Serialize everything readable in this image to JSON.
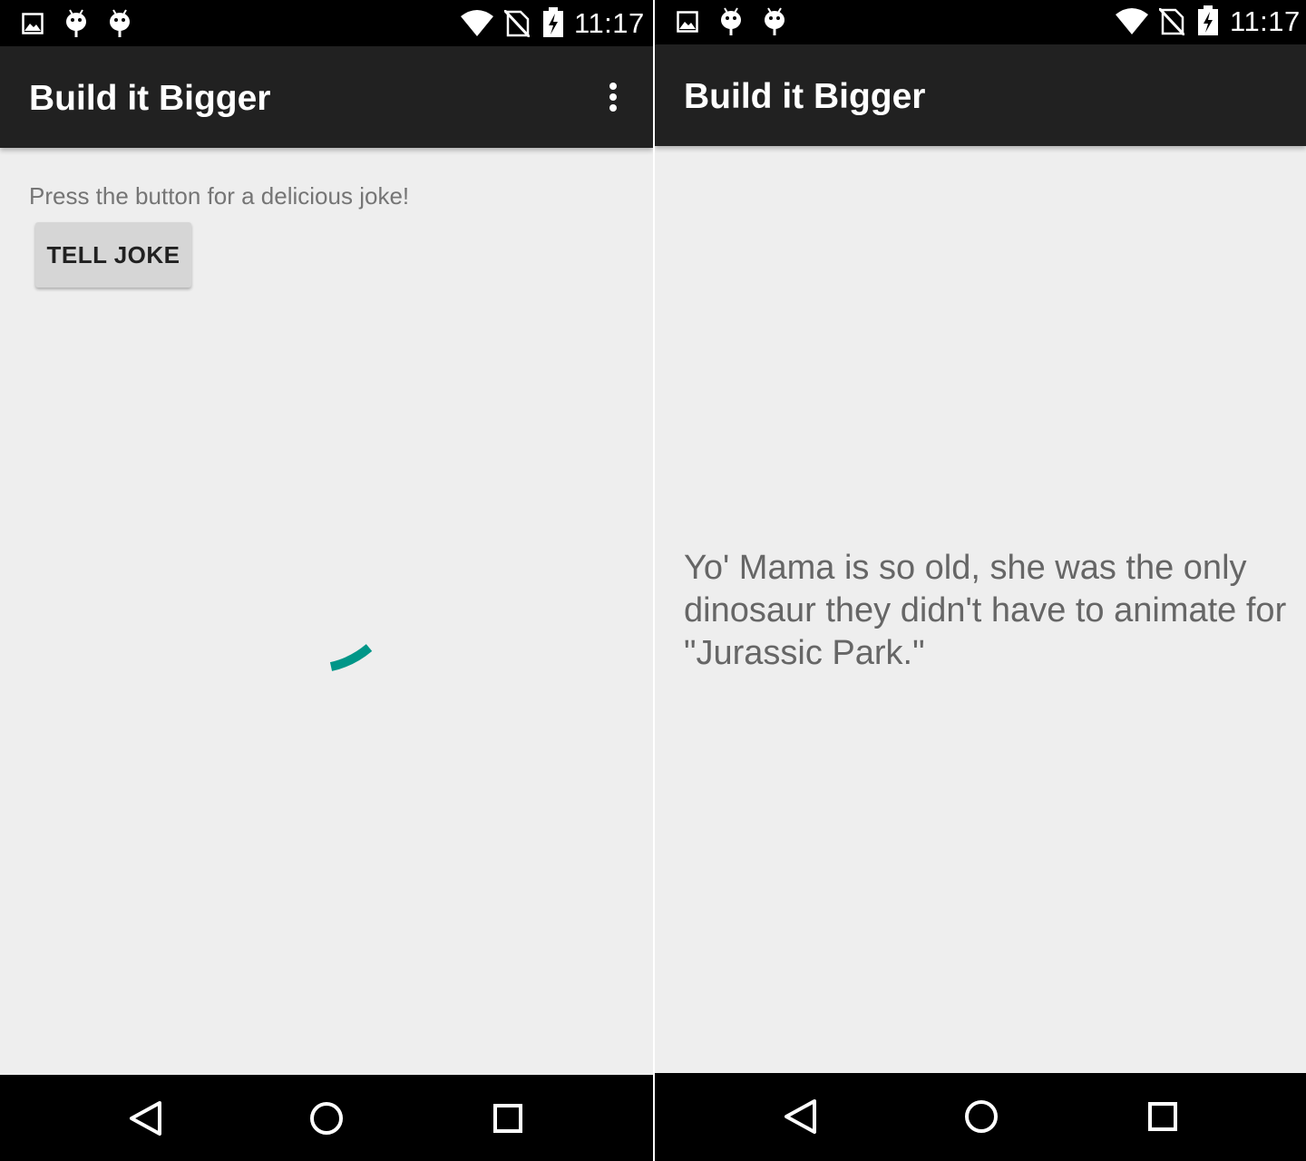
{
  "status_bar": {
    "time": "11:17",
    "left_icons": [
      "image-notification-icon",
      "android-notification-icon",
      "android-notification-icon"
    ],
    "right_icons": [
      "wifi-icon",
      "no-sim-icon",
      "battery-charging-icon"
    ]
  },
  "left_screen": {
    "app_title": "Build it Bigger",
    "prompt": "Press the button for a delicious joke!",
    "button_label": "TELL JOKE",
    "has_overflow_menu": true,
    "spinner_color": "#009688"
  },
  "right_screen": {
    "app_title": "Build it Bigger",
    "joke": "Yo' Mama is so old, she was the only dinosaur they didn't have to animate for \"Jurassic Park.\""
  },
  "navigation": [
    "back",
    "home",
    "recents"
  ],
  "colors": {
    "status_bar": "#000000",
    "app_bar": "#212121",
    "background": "#eeeeee",
    "accent": "#009688",
    "button": "#d6d6d6"
  }
}
